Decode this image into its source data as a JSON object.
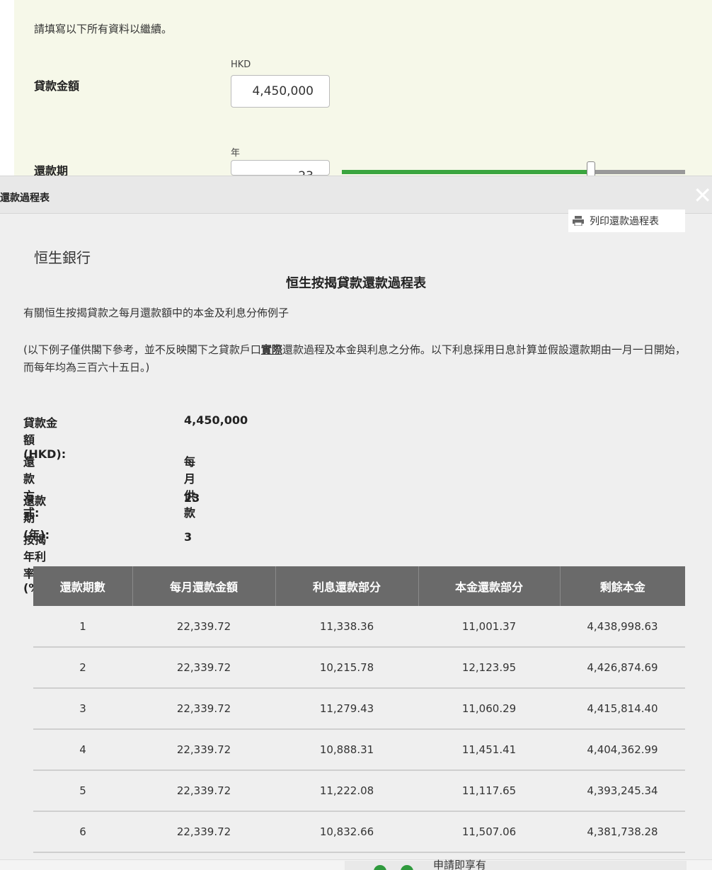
{
  "background_form": {
    "intro": "請填寫以下所有資料以繼續。",
    "loan_amount": {
      "label": "貸款金額",
      "unit": "HKD",
      "value": "4,450,000"
    },
    "term": {
      "label": "還款期",
      "unit": "年",
      "value": "23",
      "slider_fraction": 0.73
    }
  },
  "modal": {
    "title": "還款過程表",
    "close_icon": "close-icon",
    "print_label": "列印還款過程表",
    "bank_name": "恒生銀行",
    "doc_title": "恒生按揭貸款還款過程表",
    "description": "有關恒生按揭貸款之每月還款額中的本金及利息分佈例子",
    "note_before": "(以下例子僅供閣下參考，並不反映閣下之貸款戶口",
    "note_emphasis": "實際",
    "note_after": "還款過程及本金與利息之分佈。以下利息採用日息計算並假設還款期由一月一日開始，而每年均為三百六十五日。)",
    "summary": [
      {
        "label": "貸款金額 (HKD):",
        "value": "4,450,000"
      },
      {
        "label": "還款方式:",
        "value": "每月供款"
      },
      {
        "label": "還款期 (年):",
        "value": "23"
      },
      {
        "label": "按揭年利率 (%):",
        "value": "3"
      }
    ],
    "table": {
      "headers": [
        "還款期數",
        "每月還款金額",
        "利息還款部分",
        "本金還款部分",
        "剩餘本金"
      ],
      "rows": [
        [
          "1",
          "22,339.72",
          "11,338.36",
          "11,001.37",
          "4,438,998.63"
        ],
        [
          "2",
          "22,339.72",
          "10,215.78",
          "12,123.95",
          "4,426,874.69"
        ],
        [
          "3",
          "22,339.72",
          "11,279.43",
          "11,060.29",
          "4,415,814.40"
        ],
        [
          "4",
          "22,339.72",
          "10,888.31",
          "11,451.41",
          "4,404,362.99"
        ],
        [
          "5",
          "22,339.72",
          "11,222.08",
          "11,117.65",
          "4,393,245.34"
        ],
        [
          "6",
          "22,339.72",
          "10,832.66",
          "11,507.06",
          "4,381,738.28"
        ]
      ]
    }
  },
  "bottom": {
    "text": "申請即享有"
  },
  "colors": {
    "accent_green": "#3aa53f",
    "table_header": "#6a6a6a",
    "panel_bg": "#f6f8e9"
  }
}
